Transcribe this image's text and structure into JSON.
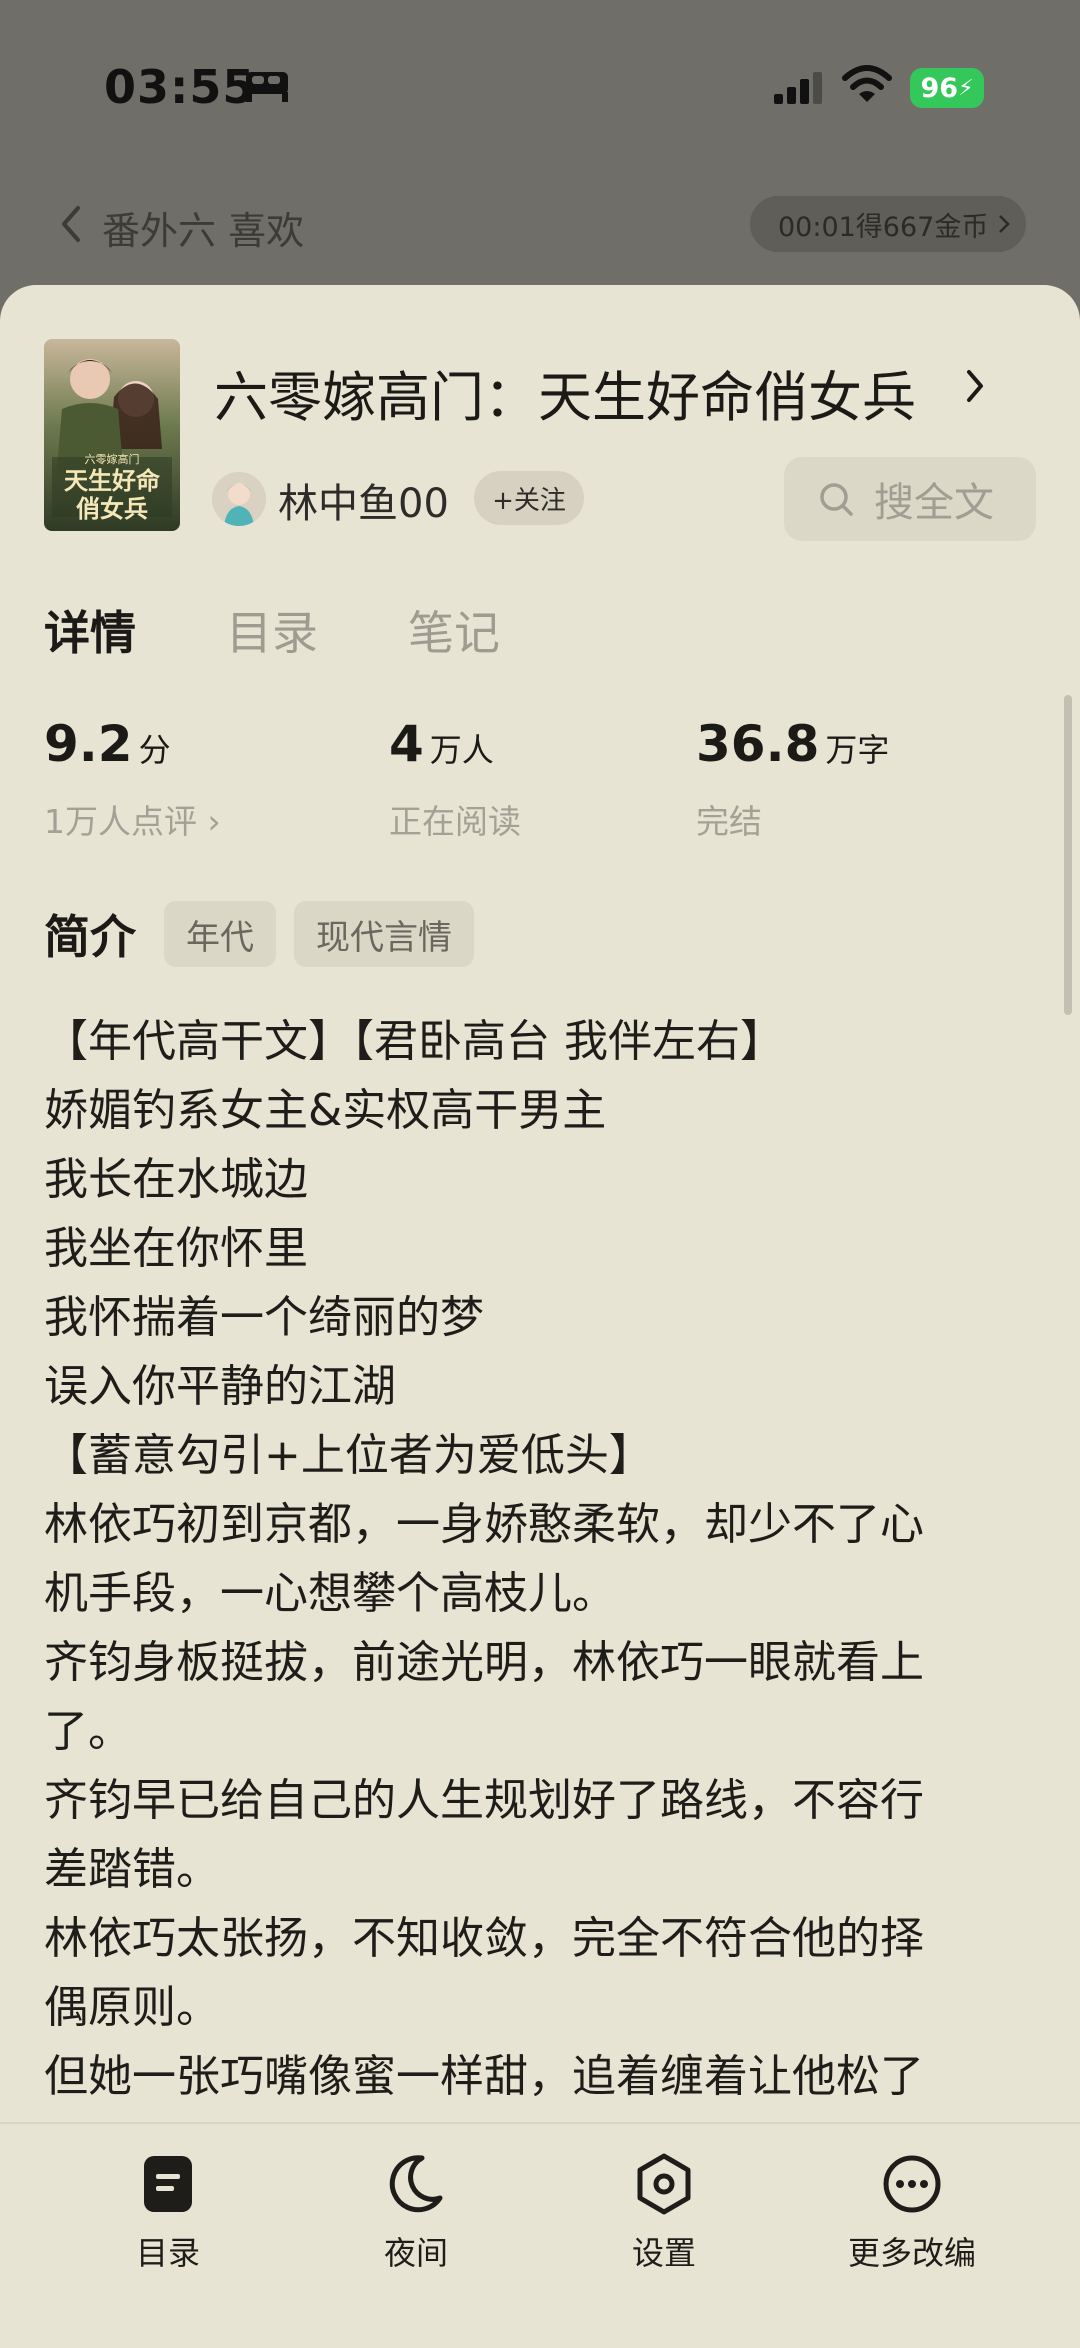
{
  "status": {
    "time": "03:55",
    "battery": "96"
  },
  "reader": {
    "chapter_title": "番外六 喜欢",
    "coin_reward": "00:01得667金币"
  },
  "book": {
    "title": "六零嫁高门：天生好命俏女兵",
    "cover_text": [
      "六零嫁高门",
      "天生好命",
      "俏女兵"
    ],
    "author": "林中鱼00",
    "follow_label": "+关注",
    "search_label": "搜全文"
  },
  "tabs": [
    {
      "label": "详情",
      "active": true
    },
    {
      "label": "目录",
      "active": false
    },
    {
      "label": "笔记",
      "active": false
    }
  ],
  "stats": [
    {
      "value": "9.2",
      "unit": "分",
      "sub": "1万人点评 ›"
    },
    {
      "value": "4",
      "unit": "万人",
      "sub": "正在阅读"
    },
    {
      "value": "36.8",
      "unit": "万字",
      "sub": "完结"
    }
  ],
  "intro": {
    "label": "简介",
    "tags": [
      "年代",
      "现代言情"
    ],
    "lines": [
      "【年代高干文】【君卧高台 我伴左右】",
      "娇媚钓系女主&实权高干男主",
      "我长在水城边",
      "我坐在你怀里",
      "我怀揣着一个绮丽的梦",
      "误入你平静的江湖",
      "【蓄意勾引+上位者为爱低头】",
      "林依巧初到京都，一身娇憨柔软，却少不了心",
      "机手段，一心想攀个高枝儿。",
      "齐钧身板挺拔，前途光明，林依巧一眼就看上",
      "了。",
      "齐钧早已给自己的人生规划好了路线，不容行",
      "差踏错。",
      "林依巧太张扬，不知收敛，完全不符合他的择",
      "偶原则。",
      "但她一张巧嘴像蜜一样甜，追着缠着让他松了"
    ]
  },
  "bottom_nav": [
    {
      "label": "目录",
      "icon": "catalog-icon"
    },
    {
      "label": "夜间",
      "icon": "moon-icon"
    },
    {
      "label": "设置",
      "icon": "settings-icon"
    },
    {
      "label": "更多改编",
      "icon": "more-icon"
    }
  ]
}
